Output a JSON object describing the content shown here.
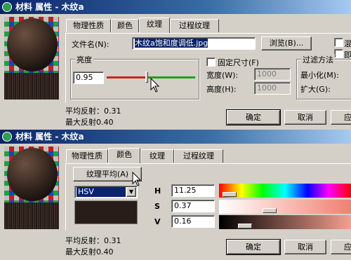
{
  "dialog1": {
    "title": "材料 属性 - 木纹a",
    "tabs": [
      "物理性质",
      "颜色",
      "纹理",
      "过程纹理"
    ],
    "active_tab": 2,
    "filename_label": "文件名(N):",
    "filename_value": "木纹a饱和度调低.jpg",
    "browse_button": "浏览(B)...",
    "brightness": {
      "group_label": "亮度",
      "value": "0.95",
      "slider_level": 0.45
    },
    "fixed_size": {
      "checkbox_label": "固定尺寸(F)",
      "width_label": "宽度(W):",
      "width_value": "1000",
      "height_label": "高度(H):",
      "height_value": "1000"
    },
    "filter": {
      "group_label": "过滤方法",
      "min_label": "最小化(M):",
      "max_label": "扩大(G):"
    },
    "right_checks": [
      "混",
      "即"
    ],
    "avg_reflect": "平均反射：0.31",
    "max_reflect": "最大反射0.40",
    "ok_button": "确定",
    "cancel_button": "取消",
    "apply_button": "应"
  },
  "dialog2": {
    "title": "材料 属性 - 木纹a",
    "tabs": [
      "物理性质",
      "颜色",
      "纹理",
      "过程纹理"
    ],
    "active_tab": 1,
    "texture_avg_button": "纹理平均(A)",
    "color_model": "HSV",
    "h_label": "H",
    "h_value": "11.25",
    "h_level": 0.03,
    "s_label": "S",
    "s_value": "0.37",
    "s_level": 0.37,
    "v_label": "V",
    "v_value": "0.16",
    "v_level": 0.16,
    "swatch_color": "#291d19",
    "avg_reflect": "平均反射：0.31",
    "max_reflect": "最大反射0.40",
    "ok_button": "确定",
    "cancel_button": "取消",
    "apply_button": "应"
  }
}
